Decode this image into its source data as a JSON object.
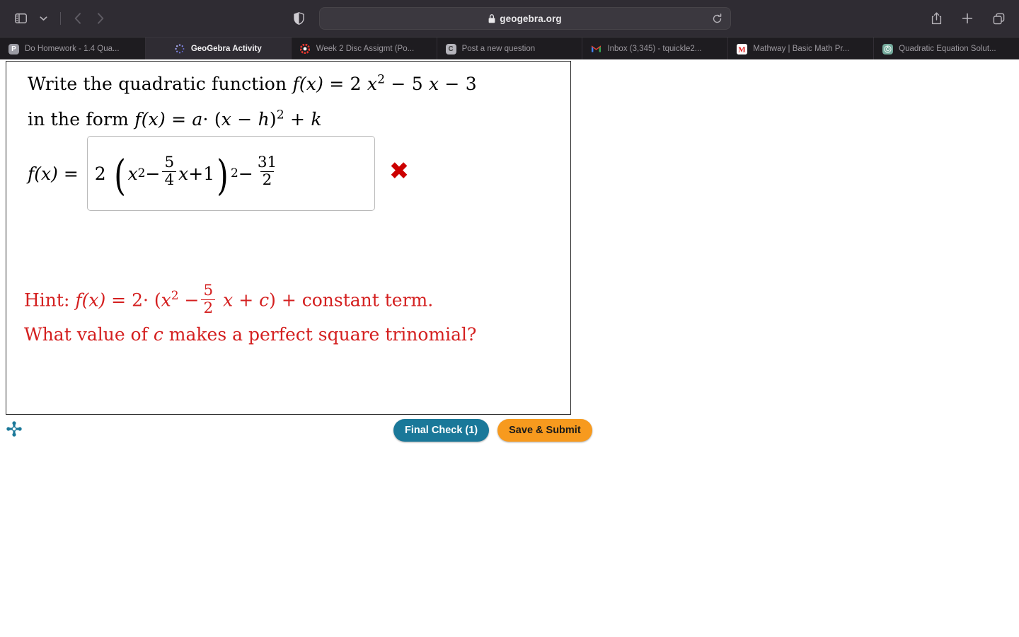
{
  "browser": {
    "toolbar": {
      "sidebar_toggle": "sidebar-toggle",
      "tab_group_chevron": "chevron-down",
      "back": "back-arrow",
      "forward": "forward-arrow",
      "shield": "privacy-shield",
      "lock": "lock",
      "url": "geogebra.org",
      "reload": "reload",
      "share": "share",
      "new_tab": "plus",
      "tab_overview": "tab-overview"
    },
    "tabs": [
      {
        "title": "Do Homework - 1.4 Qua...",
        "favicon": "pearson",
        "favicon_letter": "P",
        "active": false
      },
      {
        "title": "GeoGebra Activity",
        "favicon": "geogebra-spinner",
        "favicon_letter": "",
        "active": true
      },
      {
        "title": "Week 2 Disc Assigmt (Po...",
        "favicon": "red-ring",
        "favicon_letter": "",
        "active": false
      },
      {
        "title": "Post a new question",
        "favicon": "course-hero",
        "favicon_letter": "C",
        "active": false
      },
      {
        "title": "Inbox (3,345) - tquickle2...",
        "favicon": "gmail",
        "favicon_letter": "",
        "active": false
      },
      {
        "title": "Mathway | Basic Math Pr...",
        "favicon": "mathway",
        "favicon_letter": "M",
        "active": false
      },
      {
        "title": "Quadratic Equation Solut...",
        "favicon": "chatgpt",
        "favicon_letter": "",
        "active": false
      }
    ]
  },
  "applet": {
    "prompt": {
      "line1_pre": "Write the quadratic function",
      "fx": "f",
      "of_x": "(x)",
      "equals": "=",
      "coef_a": "2",
      "var_x": "x",
      "exp_2": "2",
      "minus": "−",
      "coef_b": "5",
      "const_c": "3",
      "line2_pre": "in the form",
      "form_a": "a",
      "form_dot": "·",
      "form_open": "(",
      "form_x": "x",
      "form_minus": "−",
      "form_h": "h",
      "form_close": ")",
      "form_exp": "2",
      "form_plus": "+",
      "form_k": "k"
    },
    "answer": {
      "label_f": "f",
      "label_of_x": "(x)",
      "label_eq": "=",
      "lead_coef": "2",
      "open_paren": "(",
      "inner_x": "x",
      "inner_exp": "2",
      "inner_minus": "−",
      "frac1_num": "5",
      "frac1_den": "4",
      "inner_x2": "x",
      "inner_plus": "+",
      "inner_const": "1",
      "close_paren": ")",
      "outer_exp": "2",
      "outer_minus": "−",
      "frac2_num": "31",
      "frac2_den": "2",
      "status_icon": "cross-mark",
      "status_glyph": "✖",
      "status_color": "#cc0000"
    },
    "hint": {
      "label": "Hint:",
      "f": "f",
      "of_x": "(x)",
      "eq": "=",
      "coef": "2",
      "dot": "·",
      "open": "(",
      "x": "x",
      "exp": "2",
      "minus": "−",
      "frac_num": "5",
      "frac_den": "2",
      "x2": "x",
      "plus": "+",
      "c": "c",
      "close": ")",
      "plus2": "+",
      "tail": "constant term.",
      "question_pre": "What value of",
      "question_var": "c",
      "question_post": "makes a perfect square trinomial?",
      "color": "#d41f1f"
    },
    "footer": {
      "logo": "geogebra-logo",
      "final_check_label": "Final Check (1)",
      "save_submit_label": "Save & Submit",
      "final_check_color": "#1a7899",
      "save_submit_color": "#f79a1e"
    }
  }
}
